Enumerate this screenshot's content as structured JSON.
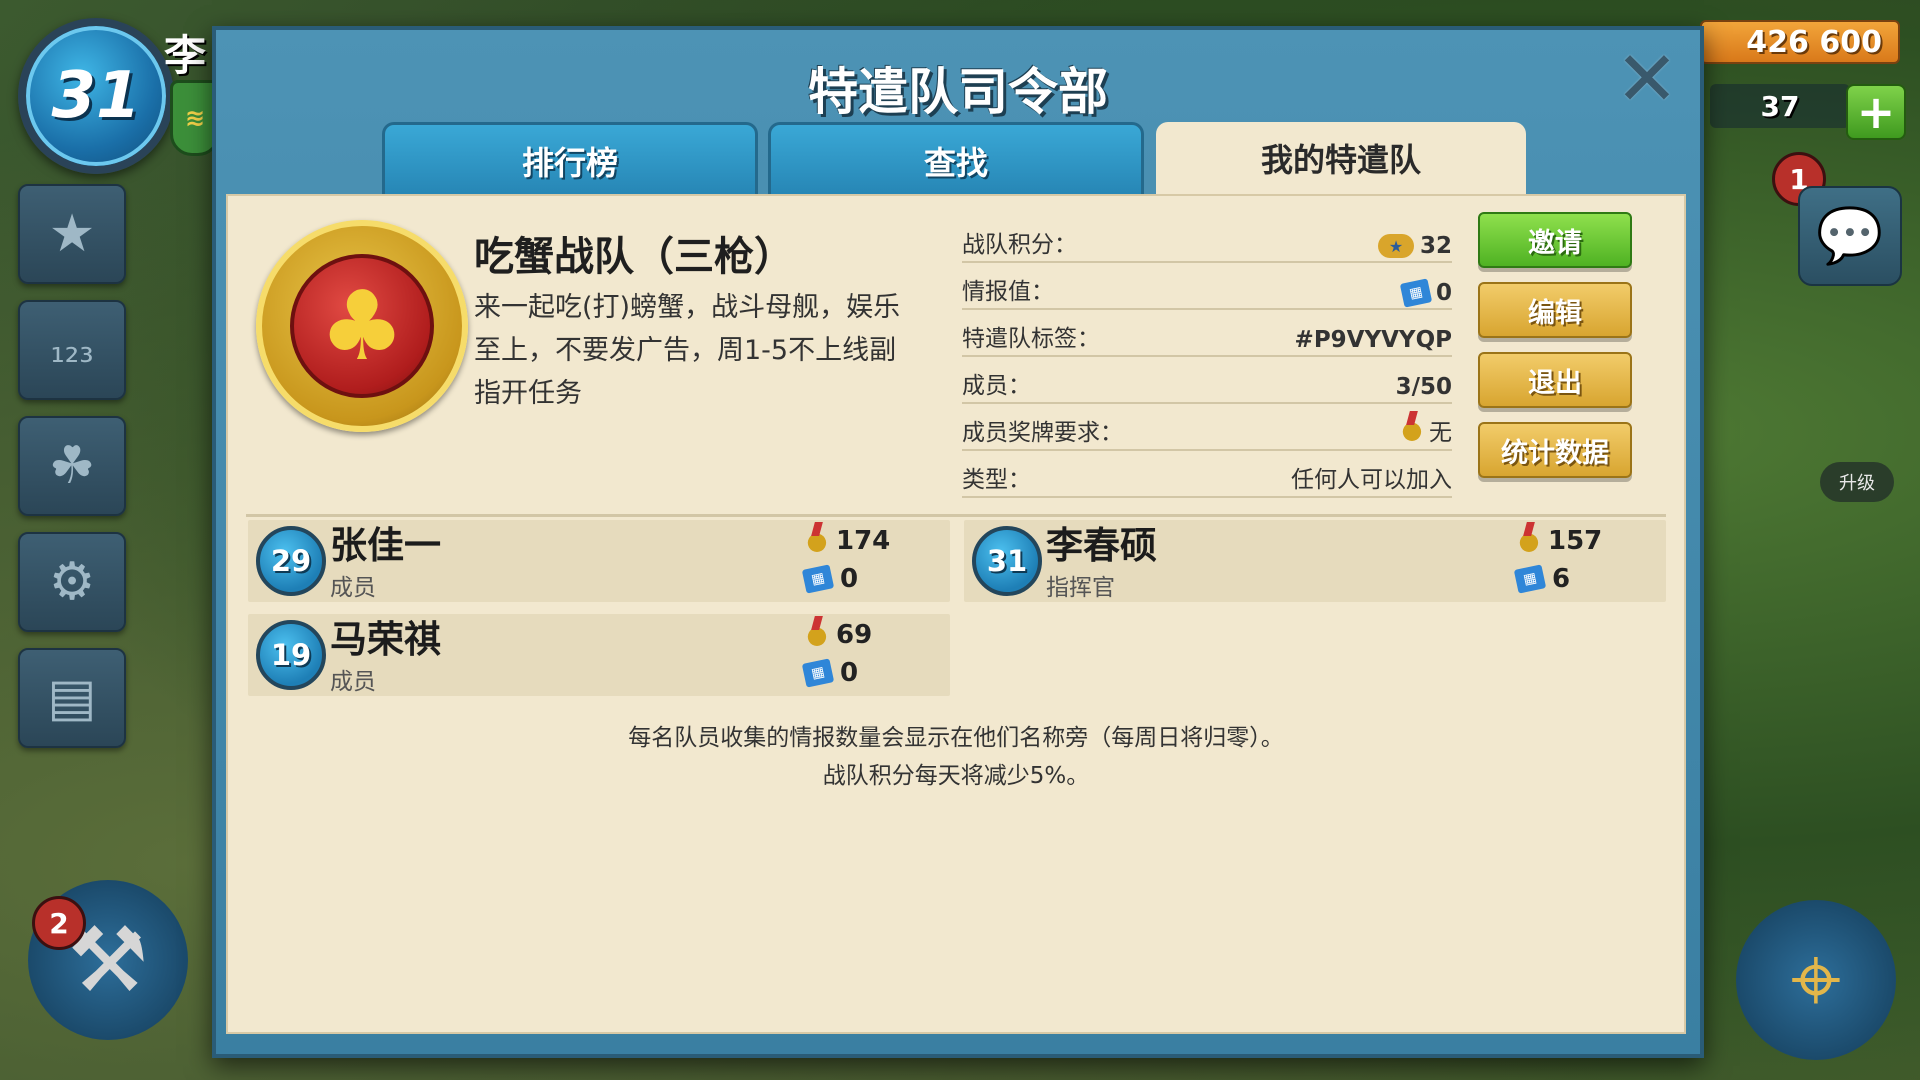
{
  "hud": {
    "player_level": "31",
    "player_name": "李",
    "gold": "426 600",
    "diamonds": "37",
    "chat_badge": "1",
    "build_badge": "2",
    "upgrade_label": "升级"
  },
  "dialog": {
    "title": "特遣队司令部",
    "tabs": [
      "排行榜",
      "查找",
      "我的特遣队"
    ],
    "active_tab": "我的特遣队"
  },
  "squad": {
    "name": "吃蟹战队（三枪）",
    "description": "来一起吃(打)螃蟹，战斗母舰，娱乐至上，不要发广告，周1-5不上线副指开任务",
    "stats": [
      {
        "label": "战队积分：",
        "value": "32",
        "icon": "squad-points-icon"
      },
      {
        "label": "情报值：",
        "value": "0",
        "icon": "intel-icon"
      },
      {
        "label": "特遣队标签：",
        "value": "#P9VYVYQP",
        "icon": ""
      },
      {
        "label": "成员：",
        "value": "3/50",
        "icon": ""
      },
      {
        "label": "成员奖牌要求：",
        "value": "无",
        "icon": "medal-icon"
      },
      {
        "label": "类型：",
        "value": "任何人可以加入",
        "icon": ""
      }
    ]
  },
  "actions": {
    "invite": "邀请",
    "edit": "编辑",
    "leave": "退出",
    "statistics": "统计数据"
  },
  "members": [
    {
      "level": "29",
      "name": "张佳一",
      "role": "成员",
      "medals": "174",
      "intel": "0"
    },
    {
      "level": "31",
      "name": "李春硕",
      "role": "指挥官",
      "medals": "157",
      "intel": "6"
    },
    {
      "level": "19",
      "name": "马荣祺",
      "role": "成员",
      "medals": "69",
      "intel": "0"
    }
  ],
  "footnotes": [
    "每名队员收集的情报数量会显示在他们名称旁（每周日将归零）。",
    "战队积分每天将减少5%。"
  ]
}
